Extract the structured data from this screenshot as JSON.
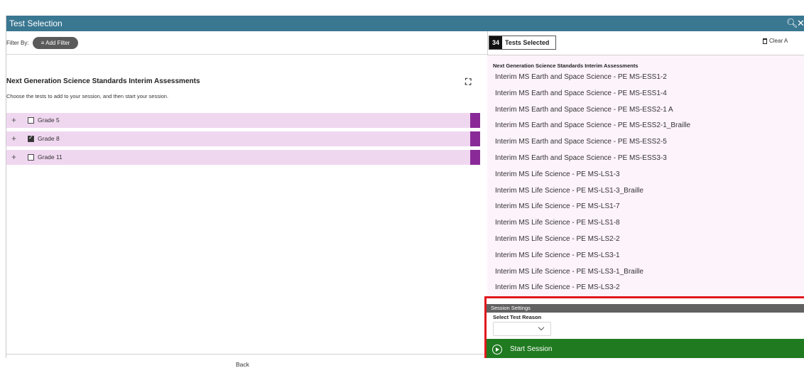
{
  "window": {
    "title": "Test Selection",
    "search_icon": "search-icon",
    "close_icon": "close-icon"
  },
  "left": {
    "filter_label": "Filter By:",
    "add_filter_label": "≡ Add Filter",
    "section_title": "Next Generation Science Standards Interim Assessments",
    "instructions": "Choose the tests to add to your session, and then start your session.",
    "grades": [
      {
        "label": "Grade 5",
        "checked": false
      },
      {
        "label": "Grade 8",
        "checked": true
      },
      {
        "label": "Grade 11",
        "checked": false
      }
    ],
    "back_label": "Back"
  },
  "right": {
    "selected_count": "34",
    "selected_label": "Tests Selected",
    "clear_all_label": "Clear A",
    "tests_heading": "Next Generation Science Standards Interim Assessments",
    "tests": [
      "Interim MS Earth and Space Science - PE MS-ESS1-2",
      "Interim MS Earth and Space Science - PE MS-ESS1-4",
      "Interim MS Earth and Space Science - PE MS-ESS2-1 A",
      "Interim MS Earth and Space Science - PE MS-ESS2-1_Braille",
      "Interim MS Earth and Space Science - PE MS-ESS2-5",
      "Interim MS Earth and Space Science - PE MS-ESS3-3",
      "Interim MS Life Science - PE MS-LS1-3",
      "Interim MS Life Science - PE MS-LS1-3_Braille",
      "Interim MS Life Science - PE MS-LS1-7",
      "Interim MS Life Science - PE MS-LS1-8",
      "Interim MS Life Science - PE MS-LS2-2",
      "Interim MS Life Science - PE MS-LS3-1",
      "Interim MS Life Science - PE MS-LS3-1_Braille",
      "Interim MS Life Science - PE MS-LS3-2"
    ]
  },
  "session": {
    "header": "Session Settings",
    "reason_label": "Select Test Reason",
    "reason_value": "",
    "start_label": "Start Session"
  },
  "colors": {
    "title_bar": "#3a7791",
    "grade_row": "#f0d7f0",
    "grade_tab": "#8a2a98",
    "start_button": "#207a20",
    "highlight_border": "#e1191e"
  }
}
